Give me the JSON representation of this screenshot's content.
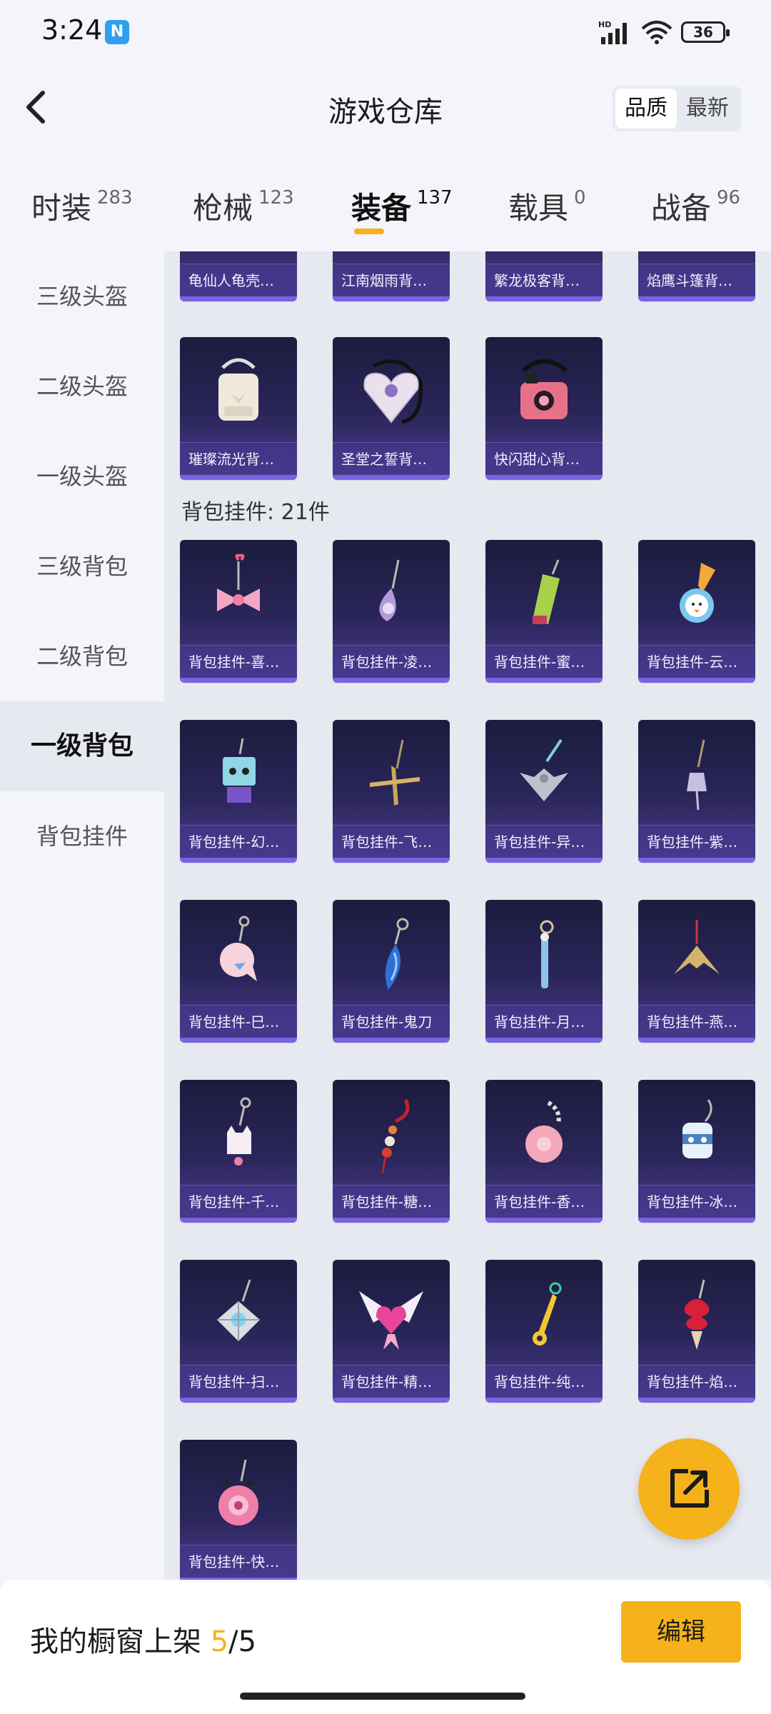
{
  "status_bar": {
    "time": "3:24",
    "nfc": "N",
    "battery": "36"
  },
  "header": {
    "title": "游戏仓库",
    "sort_options": [
      "品质",
      "最新"
    ],
    "sort_active": "品质"
  },
  "tabs": [
    {
      "label": "时装",
      "count": "283"
    },
    {
      "label": "枪械",
      "count": "123"
    },
    {
      "label": "装备",
      "count": "137"
    },
    {
      "label": "载具",
      "count": "0"
    },
    {
      "label": "战备",
      "count": "96"
    }
  ],
  "sidebar": [
    {
      "label": "三级头盔"
    },
    {
      "label": "二级头盔"
    },
    {
      "label": "一级头盔"
    },
    {
      "label": "三级背包"
    },
    {
      "label": "二级背包"
    },
    {
      "label": "一级背包"
    },
    {
      "label": "背包挂件"
    }
  ],
  "backpacks_partial": [
    "龟仙人龟壳…",
    "江南烟雨背…",
    "繁龙极客背…",
    "焰鹰斗篷背…"
  ],
  "backpacks": [
    "璀璨流光背…",
    "圣堂之誓背…",
    "快闪甜心背…"
  ],
  "charms_section": {
    "title": "背包挂件: 21件"
  },
  "charms": [
    "背包挂件-喜…",
    "背包挂件-凌…",
    "背包挂件-蜜…",
    "背包挂件-云…",
    "背包挂件-幻…",
    "背包挂件-飞…",
    "背包挂件-异…",
    "背包挂件-紫…",
    "背包挂件-巳…",
    "背包挂件-鬼刀",
    "背包挂件-月…",
    "背包挂件-燕…",
    "背包挂件-千…",
    "背包挂件-糖…",
    "背包挂件-香…",
    "背包挂件-冰…",
    "背包挂件-扫…",
    "背包挂件-精…",
    "背包挂件-纯…",
    "背包挂件-焰…",
    "背包挂件-快…"
  ],
  "bottom_bar": {
    "prefix": "我的橱窗上架 ",
    "current": "5",
    "suffix": "/5",
    "edit_label": "编辑"
  },
  "colors": {
    "accent": "#f5b21a",
    "card_dark": "#1b1c3e",
    "card_light": "#4a3d8a"
  }
}
